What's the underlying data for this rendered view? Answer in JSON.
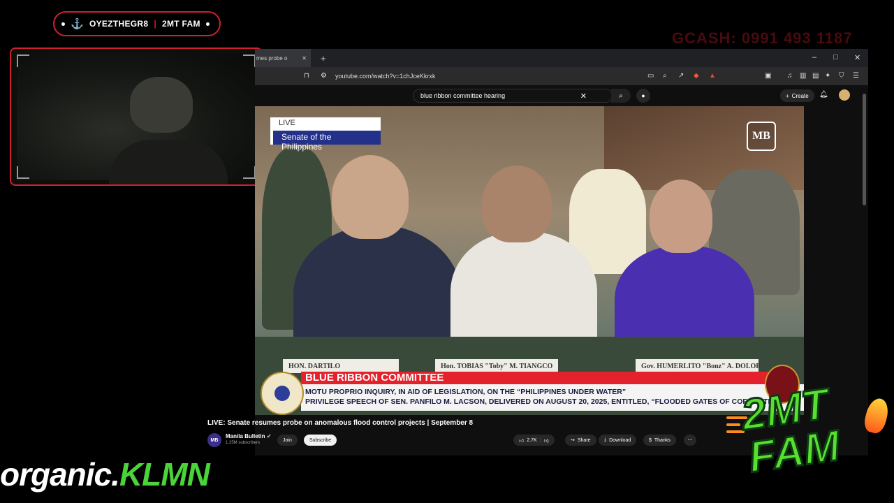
{
  "overlay": {
    "streamer_name": "OYEZTHEGR8",
    "separator": "|",
    "group_name": "2MT FAM",
    "gcash": "GCASH: 0991 493 1187",
    "organic_part1": "organic.",
    "organic_part2": "KLMN",
    "fam_logo_line1": "2MT",
    "fam_logo_line2": "FAM"
  },
  "browser": {
    "tab_title": "mes probe o",
    "url": "youtube.com/watch?v=1chJceKkrxk",
    "window_controls": [
      "–",
      "□",
      "✕"
    ]
  },
  "youtube": {
    "search_query": "blue ribbon committee hearing",
    "create_label": "Create",
    "video": {
      "live_label": "LIVE",
      "source_label": "Senate of the Philippines",
      "watermark": "MB",
      "lower_third_title": "BLUE RIBBON COMMITTEE",
      "lower_third_line1": "MOTU PROPRIO INQUIRY, IN AID OF LEGISLATION, ON THE “PHILIPPINES UNDER WATER”",
      "lower_third_line2": "PRIVILEGE SPEECH OF SEN. PANFILO M. LACSON, DELIVERED ON AUGUST 20, 2025, ENTITLED, “FLOODED GATES OF CORRUPTION”",
      "nameplate_1": "Hon. TOBIAS \"Toby\" M. TIANGCO",
      "nameplate_2": "Gov. HUMERLITO \"Bonz\" A. DOLOR",
      "nameplate_3": "HON. DARTILO"
    },
    "title": "LIVE: Senate resumes probe on anomalous flood control projects | September 8",
    "channel_initials": "MB",
    "channel_name": "Manila Bulletin",
    "subscribers": "1.25M subscribers",
    "join_label": "Join",
    "subscribe_label": "Subscribe",
    "likes": "2.7K",
    "share_label": "Share",
    "download_label": "Download",
    "thanks_label": "Thanks",
    "more_label": "⋯"
  }
}
